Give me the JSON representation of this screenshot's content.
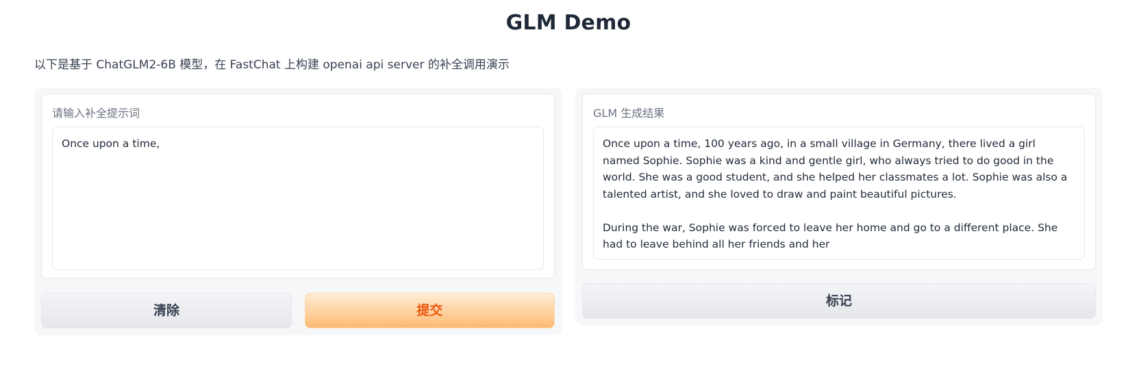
{
  "page": {
    "title": "GLM Demo",
    "description": "以下是基于 ChatGLM2-6B 模型，在 FastChat 上构建 openai api server 的补全调用演示"
  },
  "input": {
    "label": "请输入补全提示词",
    "value": "Once upon a time,"
  },
  "output": {
    "label": "GLM 生成结果",
    "value": "Once upon a time, 100 years ago, in a small village in Germany, there lived a girl named Sophie. Sophie was a kind and gentle girl, who always tried to do good in the world. She was a good student, and she helped her classmates a lot. Sophie was also a talented artist, and she loved to draw and paint beautiful pictures.\n\nDuring the war, Sophie was forced to leave her home and go to a different place. She had to leave behind all her friends and her"
  },
  "buttons": {
    "clear": "清除",
    "submit": "提交",
    "flag": "标记"
  },
  "colors": {
    "submit_text": "#ea580c",
    "submit_bg": "#fdba74",
    "panel_bg": "#f6f7f9"
  }
}
